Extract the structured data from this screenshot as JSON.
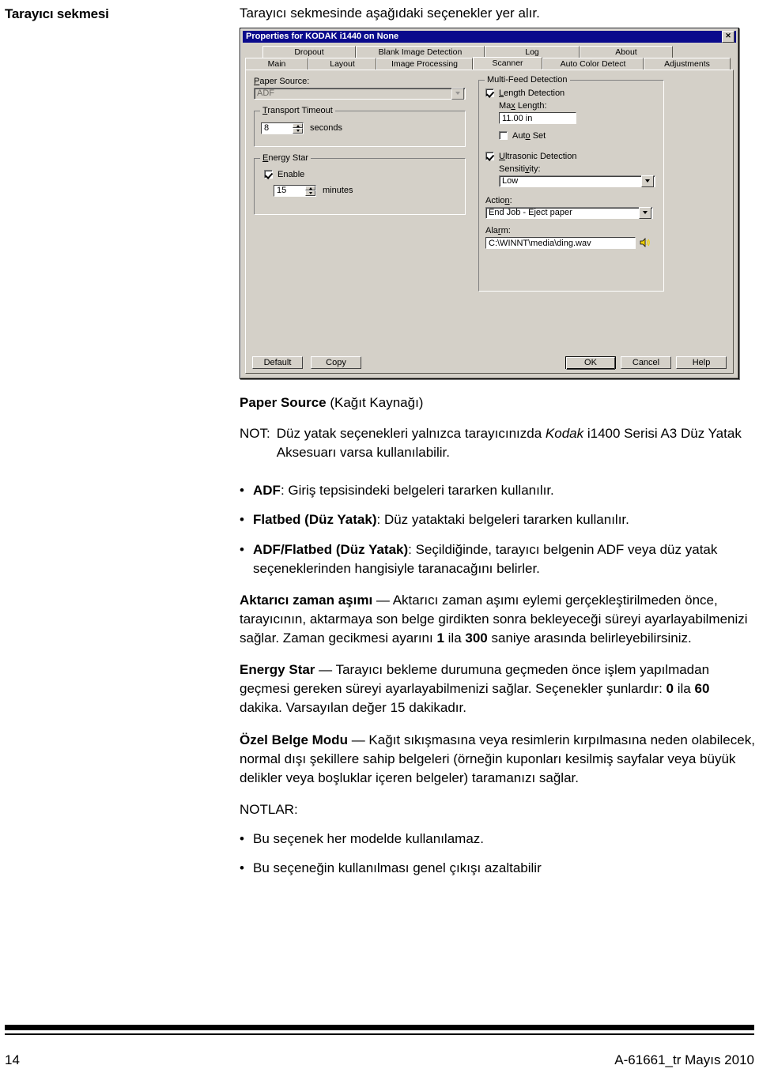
{
  "margin_heading": "Tarayıcı sekmesi",
  "intro": "Tarayıcı sekmesinde aşağıdaki seçenekler yer alır.",
  "dialog": {
    "title": "Properties for KODAK i1440 on None",
    "close_label": "✕",
    "tabs_row1": [
      {
        "label": "Dropout",
        "selected": false
      },
      {
        "label": "Blank Image Detection",
        "selected": false
      },
      {
        "label": "Log",
        "selected": false
      },
      {
        "label": "About",
        "selected": false
      }
    ],
    "tabs_row2": [
      {
        "label": "Main",
        "selected": false
      },
      {
        "label": "Layout",
        "selected": false
      },
      {
        "label": "Image Processing",
        "selected": false
      },
      {
        "label": "Scanner",
        "selected": true
      },
      {
        "label": "Auto Color Detect",
        "selected": false
      },
      {
        "label": "Adjustments",
        "selected": false
      }
    ],
    "left": {
      "paper_source_label": "Paper Source:",
      "paper_source_value": "ADF",
      "transport_group": "Transport Timeout",
      "transport_value": "8",
      "transport_unit": "seconds",
      "energy_group": "Energy Star",
      "energy_enable_label": "Enable",
      "energy_enable_checked": true,
      "energy_value": "15",
      "energy_unit": "minutes"
    },
    "right": {
      "group_title": "Multi-Feed Detection",
      "length_detection_label": "Length Detection",
      "length_detection_checked": true,
      "max_length_label": "Max Length:",
      "max_length_value": "11.00 in",
      "auto_set_label": "Auto Set",
      "auto_set_checked": false,
      "ultrasonic_label": "Ultrasonic Detection",
      "ultrasonic_checked": true,
      "sensitivity_label": "Sensitivity:",
      "sensitivity_value": "Low",
      "action_label": "Action:",
      "action_value": "End Job - Eject paper",
      "alarm_label": "Alarm:",
      "alarm_value": "C:\\WINNT\\media\\ding.wav"
    },
    "buttons": {
      "default": "Default",
      "copy": "Copy",
      "ok": "OK",
      "cancel": "Cancel",
      "help": "Help"
    }
  },
  "body": {
    "heading_bold": "Paper Source",
    "heading_rest": " (Kağıt Kaynağı)",
    "note_label": "NOT:",
    "note_pre": "Düz yatak seçenekleri yalnızca tarayıcınızda ",
    "note_italic": "Kodak",
    "note_post": " i1400 Serisi A3 Düz Yatak Aksesuarı varsa kullanılabilir.",
    "bullets": [
      {
        "bold": "ADF",
        "rest": ": Giriş tepsisindeki belgeleri tararken kullanılır."
      },
      {
        "bold": "Flatbed (Düz Yatak)",
        "rest": ": Düz yataktaki belgeleri tararken kullanılır."
      },
      {
        "bold": "ADF/Flatbed (Düz Yatak)",
        "rest": ": Seçildiğinde, tarayıcı belgenin ADF veya düz yatak seçeneklerinden hangisiyle taranacağını belirler."
      }
    ],
    "para_transport_bold": "Aktarıcı zaman aşımı",
    "para_transport_1": " — Aktarıcı zaman aşımı eylemi gerçekleştirilmeden önce, tarayıcının, aktarmaya son belge girdikten sonra bekleyeceği süreyi ayarlayabilmenizi sağlar. Zaman gecikmesi ayarını ",
    "para_transport_b1": "1",
    "para_transport_2": " ila ",
    "para_transport_b2": "300",
    "para_transport_3": " saniye arasında belirleyebilirsiniz.",
    "para_energy_bold": "Energy Star",
    "para_energy_1": " — Tarayıcı bekleme durumuna geçmeden önce işlem yapılmadan geçmesi gereken süreyi ayarlayabilmenizi sağlar. Seçenekler şunlardır: ",
    "para_energy_b1": "0",
    "para_energy_2": " ila ",
    "para_energy_b2": "60",
    "para_energy_3": " dakika. Varsayılan değer 15 dakikadır.",
    "para_special_bold": "Özel Belge Modu",
    "para_special_rest": " — Kağıt sıkışmasına veya resimlerin kırpılmasına neden olabilecek, normal dışı şekillere sahip belgeleri (örneğin kuponları kesilmiş sayfalar veya büyük delikler veya boşluklar içeren belgeler) taramanızı sağlar.",
    "notes_label": "NOTLAR:",
    "notes": [
      "Bu seçenek her modelde kullanılamaz.",
      "Bu seçeneğin kullanılması genel çıkışı azaltabilir"
    ],
    "bullet_char": "•"
  },
  "footer": {
    "page_number": "14",
    "doc_ref": "A-61661_tr  Mayıs 2010"
  }
}
